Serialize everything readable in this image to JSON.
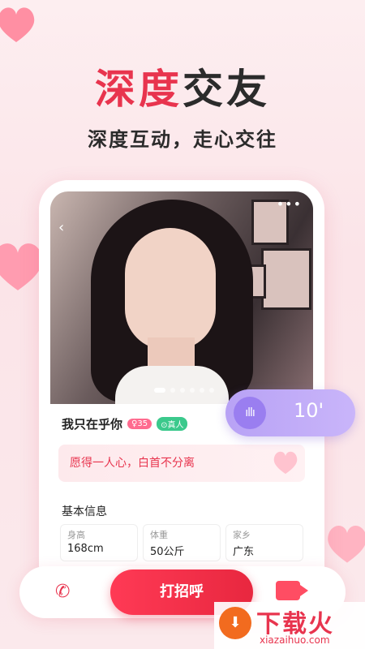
{
  "headline": {
    "accent": "深度",
    "rest": "交友"
  },
  "subheadline": "深度互动，走心交往",
  "profile": {
    "name": "我只在乎你",
    "age_tag": "♀35",
    "verified_tag": "⊙真人",
    "quote": "愿得一人心，白首不分离",
    "basic_info_title": "基本信息",
    "info": [
      {
        "label": "身高",
        "value": "168cm"
      },
      {
        "label": "体重",
        "value": "50公斤"
      },
      {
        "label": "家乡",
        "value": "广东"
      }
    ]
  },
  "voice": {
    "duration": "10'"
  },
  "actions": {
    "greet": "打招呼"
  },
  "watermark": {
    "brand": "下载火",
    "url": "xiazaihuo.com"
  },
  "colors": {
    "accent": "#e8344e",
    "voice": "#b8a2f5"
  }
}
